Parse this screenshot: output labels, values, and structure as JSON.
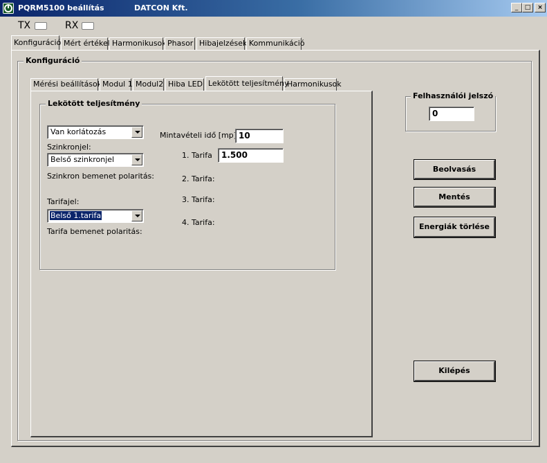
{
  "window": {
    "title": "PQRM5100 beállítás",
    "company": "DATCON Kft.",
    "controls": {
      "minimize": "_",
      "maximize": "□",
      "close": "×"
    }
  },
  "indicators": {
    "tx": "TX",
    "rx": "RX"
  },
  "main_tabs": [
    "Konfiguráció",
    "Mért értékek",
    "Harmonikusok",
    "Phasor",
    "Hibajelzések",
    "Kommunikáció"
  ],
  "config_group": {
    "title": "Konfiguráció"
  },
  "sub_tabs": [
    "Mérési beállítások",
    "Modul 1",
    "Modul2",
    "Hiba LED",
    "Lekötött teljesítmény",
    "Harmonikusok"
  ],
  "power_group": {
    "title": "Lekötött teljesítmény",
    "limit_select": "Van korlátozás",
    "sync_label": "Szinkronjel:",
    "sync_select": "Belső szinkronjel",
    "sync_polarity_label": "Szinkron bemenet polaritás:",
    "tariff_label": "Tarifajel:",
    "tariff_select": "Belső 1.tarifa",
    "tariff_polarity_label": "Tarifa bemenet polaritás:",
    "sampling_label": "Mintavételi idő [mp]:",
    "sampling_value": "10",
    "tariff1_label": "1. Tarifa",
    "tariff1_value": "1.500",
    "tariff2_label": "2. Tarifa:",
    "tariff3_label": "3. Tarifa:",
    "tariff4_label": "4. Tarifa:"
  },
  "password_group": {
    "title": "Felhasználói jelszó",
    "value": "0"
  },
  "buttons": {
    "read": "Beolvasás",
    "save": "Mentés",
    "clear_energy": "Energiák törlése",
    "exit": "Kilépés"
  }
}
